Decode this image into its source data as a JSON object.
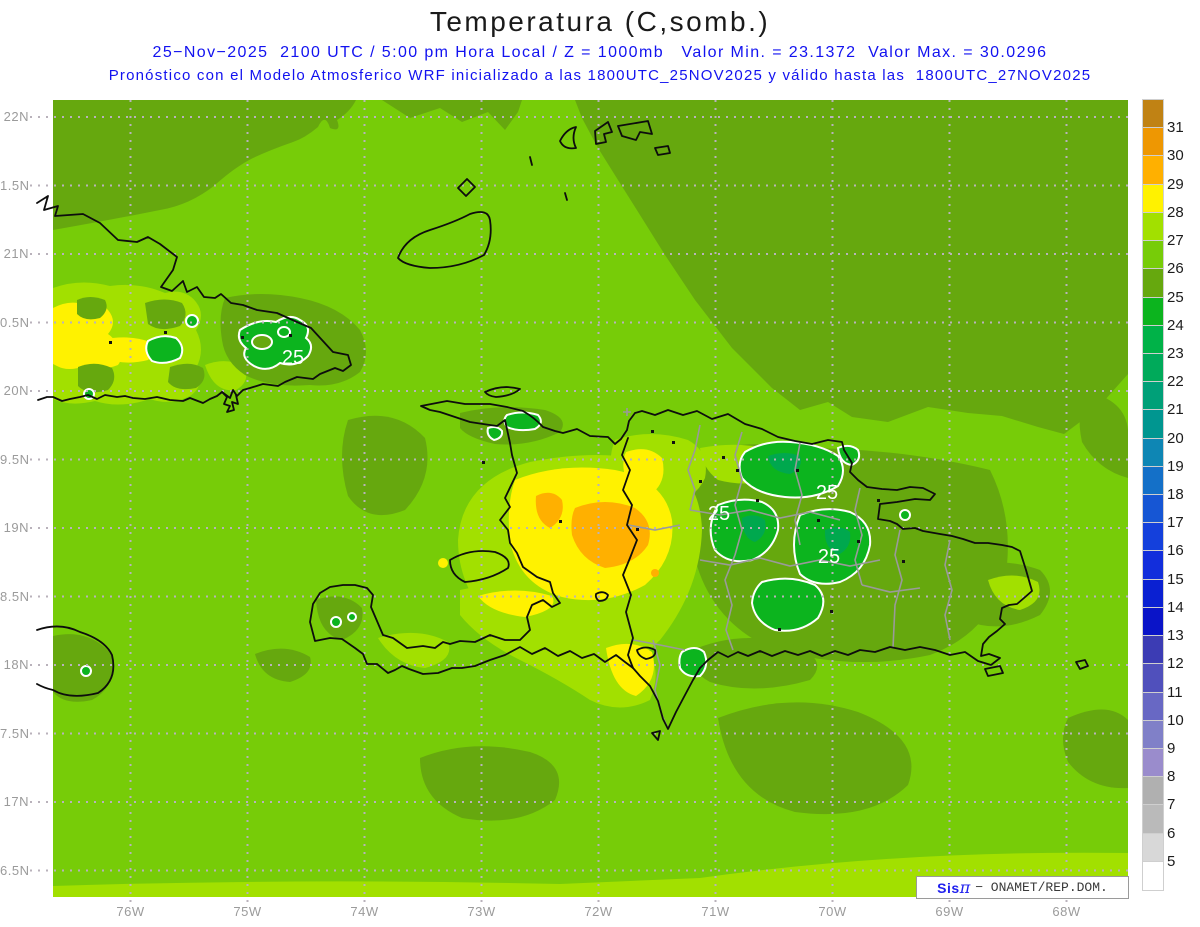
{
  "header": {
    "title": "Temperatura (C,somb.)",
    "subtitle1": "25−Nov−2025  2100 UTC / 5:00 pm Hora Local / Z = 1000mb   Valor Min. = 23.1372  Valor Max. = 30.0296",
    "subtitle2": "Pronóstico con el Modelo Atmosferico WRF inicializado a las 1800UTC_25NOV2025 y válido hasta las  1800UTC_27NOV2025"
  },
  "axes": {
    "y_ticks": [
      "22N",
      "1.5N",
      "21N",
      "0.5N",
      "20N",
      "9.5N",
      "19N",
      "8.5N",
      "18N",
      "7.5N",
      "17N",
      "6.5N"
    ],
    "x_ticks": [
      "76W",
      "75W",
      "74W",
      "73W",
      "72W",
      "71W",
      "70W",
      "69W",
      "68W"
    ]
  },
  "colorbar": {
    "tick_labels": [
      "31",
      "30",
      "29",
      "28",
      "27",
      "26",
      "25",
      "24",
      "23",
      "22",
      "21",
      "20",
      "19",
      "18",
      "17",
      "16",
      "15",
      "14",
      "13",
      "12",
      "11",
      "10",
      "9",
      "8",
      "7",
      "6",
      "5"
    ],
    "cell_colors_top_to_bottom": [
      "#c08214",
      "#ee9702",
      "#ffb000",
      "#fff200",
      "#a2e000",
      "#77cc08",
      "#66a80e",
      "#0cb41e",
      "#00b248",
      "#00aa5a",
      "#00a078",
      "#009690",
      "#0e86b4",
      "#1470c8",
      "#1656d4",
      "#1440dc",
      "#122edc",
      "#0a20d2",
      "#0a14c8",
      "#3c3cb4",
      "#5050bc",
      "#6868c4",
      "#8080c8",
      "#9a8ccc",
      "#b0b0b0",
      "#bababa",
      "#d8d8d8",
      "#ffffff"
    ]
  },
  "map": {
    "contour_labels": [
      {
        "text": "25"
      },
      {
        "text": "25"
      },
      {
        "text": "25"
      },
      {
        "text": "25"
      }
    ],
    "credit": {
      "sis": "Sis",
      "pi": "π",
      "rest": "− ONAMET/REP.DOM."
    }
  },
  "palette": {
    "t31": "#c08214",
    "t30": "#ee9702",
    "t29": "#ffb000",
    "t28": "#fff200",
    "t27": "#a2e000",
    "t26": "#77cc08",
    "t25": "#66a80e",
    "t24": "#0cb41e",
    "t23": "#00a84e",
    "contour_white": "#ffffff",
    "coastline": "#0d0d0d",
    "province": "#9a9a9a",
    "gridline": "#b9b2bb"
  }
}
